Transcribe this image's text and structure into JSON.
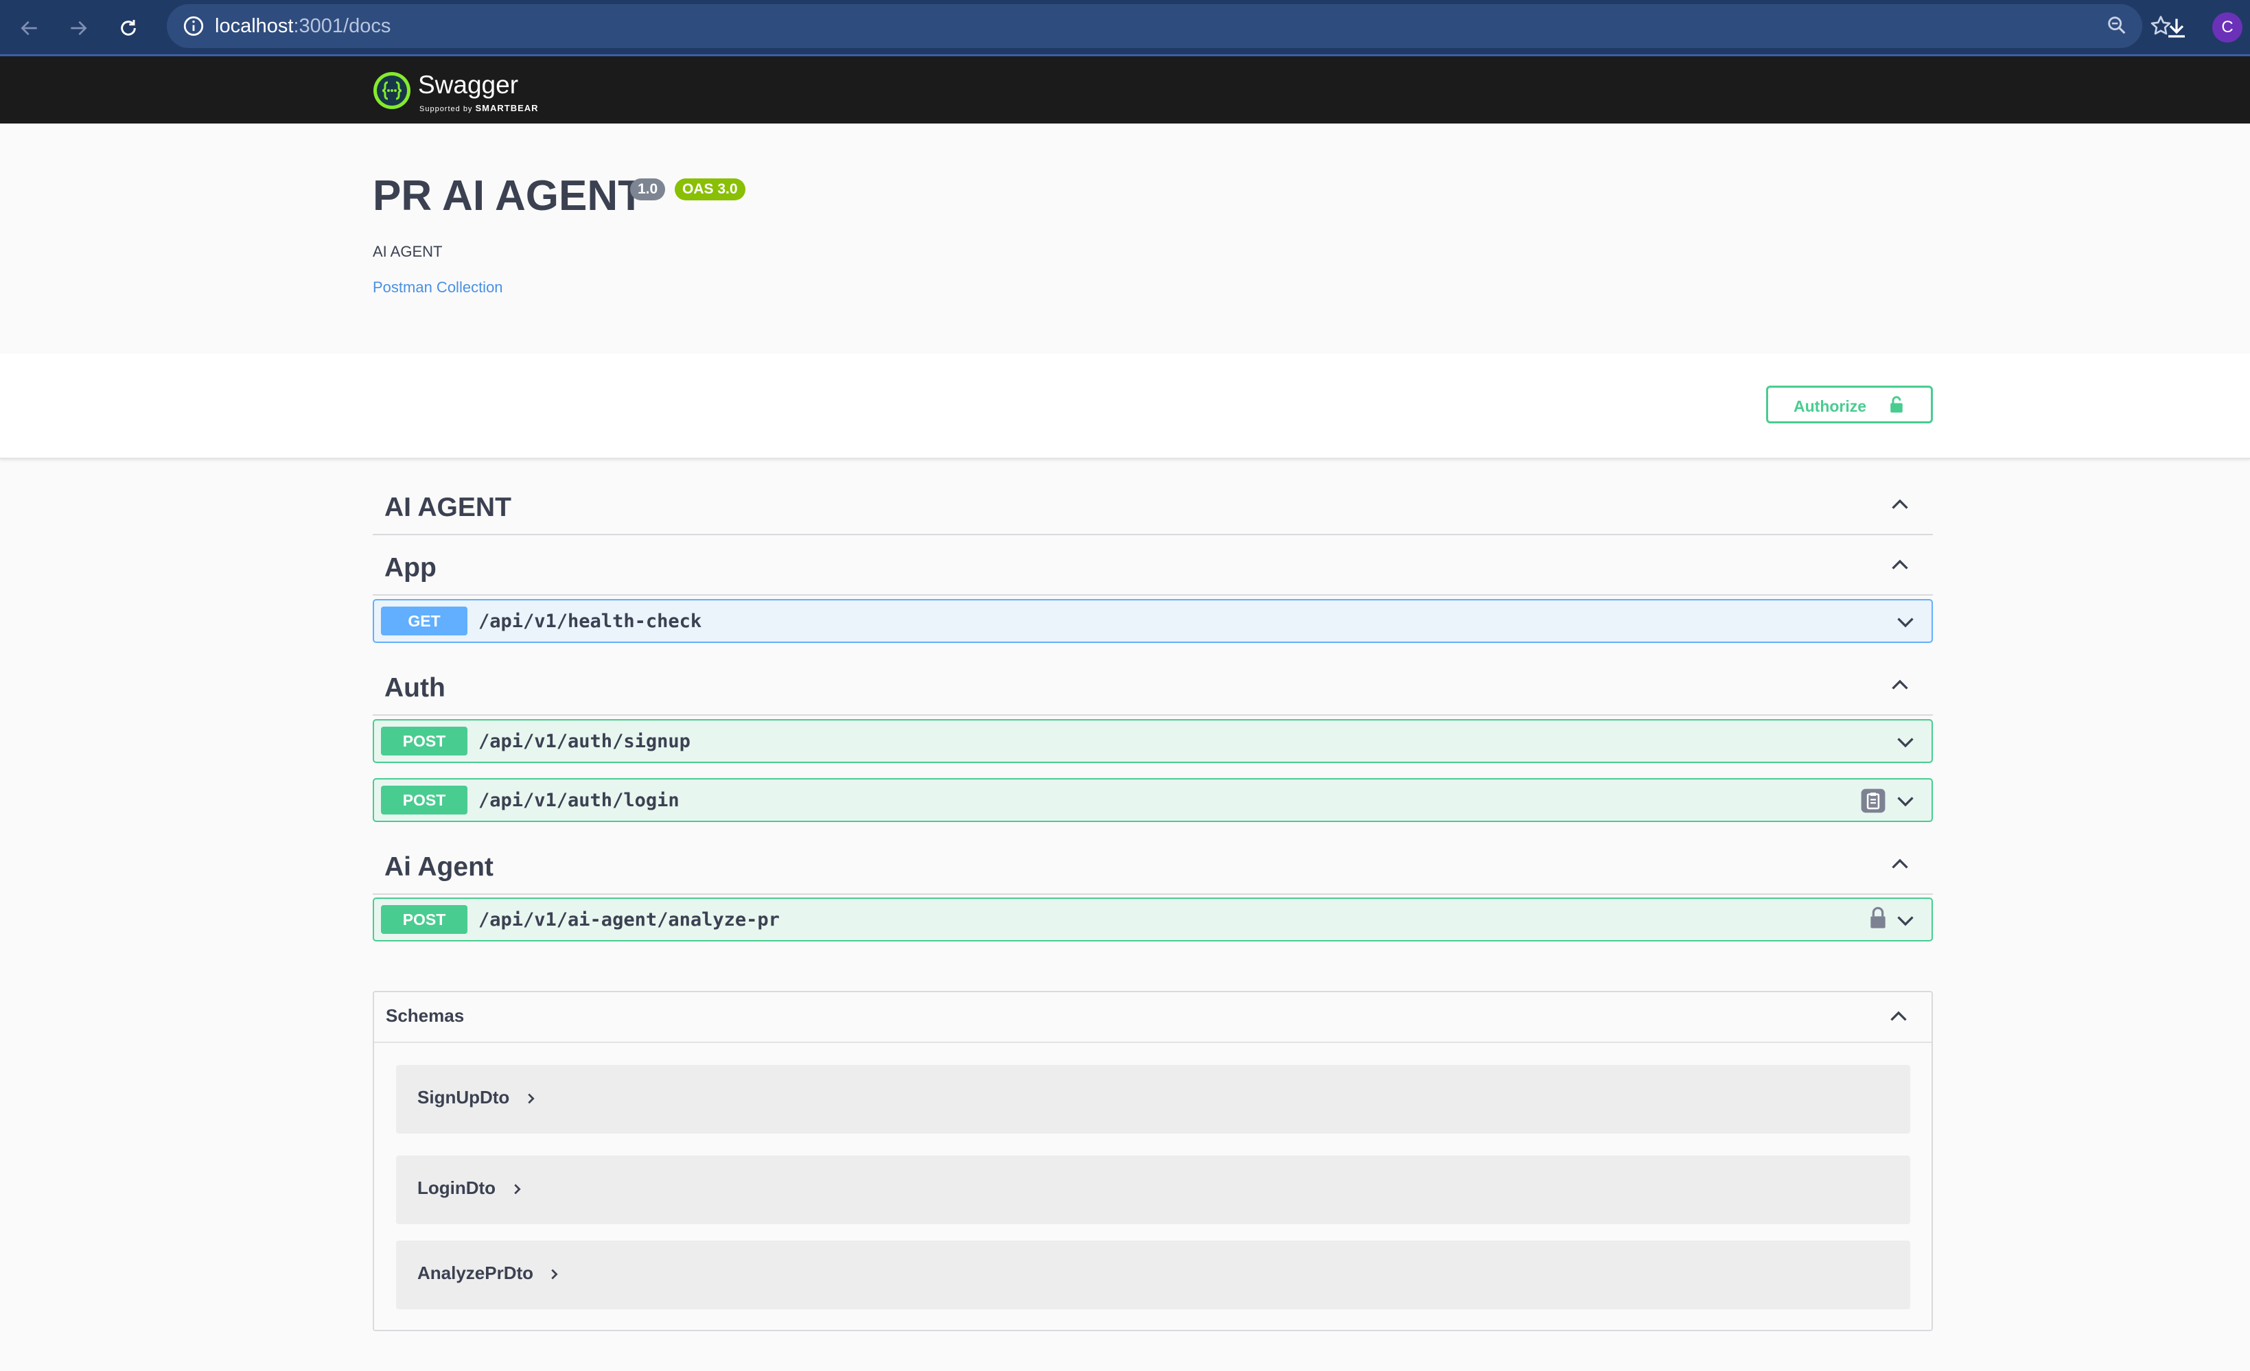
{
  "browser": {
    "url_host": "localhost",
    "url_rest": ":3001/docs",
    "profile_initial": "C",
    "icons": [
      "back-icon",
      "forward-icon",
      "reload-icon",
      "site-info-icon",
      "zoom-icon",
      "bookmark-star-icon",
      "download-icon"
    ]
  },
  "topbar": {
    "logo_text": "Swagger",
    "logo_sub_prefix": "Supported by",
    "logo_sub_brand": "SMARTBEAR"
  },
  "info": {
    "title": "PR AI AGENT",
    "version_badge": "1.0",
    "oas_badge": "OAS 3.0",
    "description": "AI AGENT",
    "link_label": "Postman Collection"
  },
  "scheme": {
    "authorize_label": "Authorize"
  },
  "tags": [
    {
      "name": "AI AGENT",
      "operations": []
    },
    {
      "name": "App",
      "operations": [
        {
          "method": "GET",
          "path": "/api/v1/health-check"
        }
      ]
    },
    {
      "name": "Auth",
      "operations": [
        {
          "method": "POST",
          "path": "/api/v1/auth/signup"
        },
        {
          "method": "POST",
          "path": "/api/v1/auth/login"
        }
      ]
    },
    {
      "name": "Ai Agent",
      "operations": [
        {
          "method": "POST",
          "path": "/api/v1/ai-agent/analyze-pr"
        }
      ]
    }
  ],
  "schemas": {
    "title": "Schemas",
    "models": [
      "SignUpDto",
      "LoginDto",
      "AnalyzePrDto"
    ]
  },
  "colors": {
    "get": "#61affe",
    "post": "#49cc90",
    "topbar": "#1b1b1b",
    "browser_chrome": "#203a66",
    "version_badge": "#7d8492",
    "oas_badge": "#89bf04",
    "link": "#4990e2"
  }
}
